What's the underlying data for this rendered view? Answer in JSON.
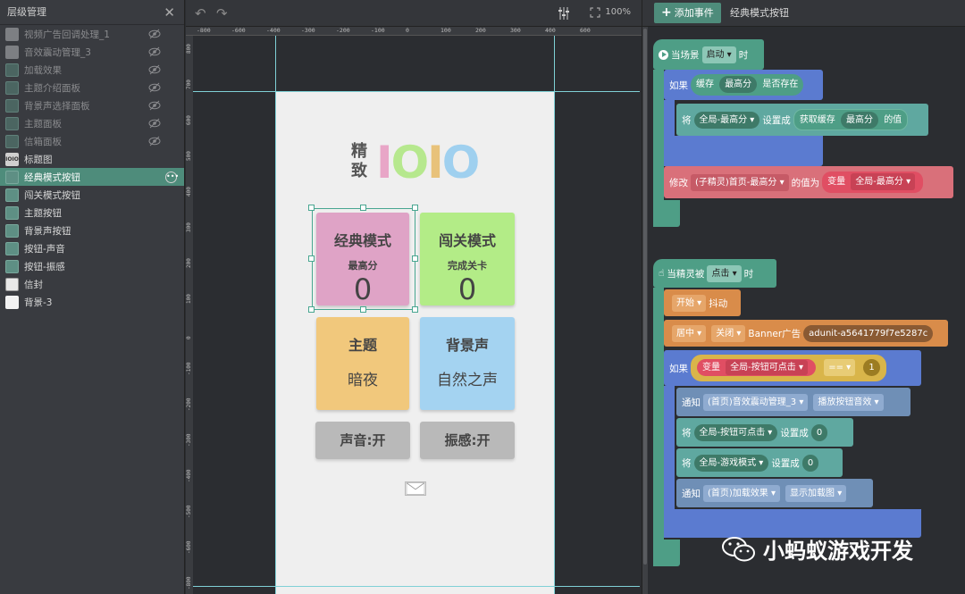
{
  "layers_panel": {
    "title": "层级管理",
    "items": [
      {
        "label": "视频广告回调处理_1",
        "icon": "grey-node-icon",
        "hidden": true
      },
      {
        "label": "音效震动管理_3",
        "icon": "grey-node-icon",
        "hidden": true
      },
      {
        "label": "加载效果",
        "icon": "image-node-icon",
        "hidden": true
      },
      {
        "label": "主题介绍面板",
        "icon": "image-node-icon",
        "hidden": true
      },
      {
        "label": "背景声选择面板",
        "icon": "image-node-icon",
        "hidden": true
      },
      {
        "label": "主题面板",
        "icon": "image-node-icon",
        "hidden": true
      },
      {
        "label": "信箱面板",
        "icon": "image-node-icon",
        "hidden": true
      },
      {
        "label": "标题图",
        "icon": "logo-node-icon",
        "hidden": false
      },
      {
        "label": "经典模式按钮",
        "icon": "image-node-icon",
        "hidden": false,
        "selected": true
      },
      {
        "label": "闯关模式按钮",
        "icon": "image-node-icon",
        "hidden": false
      },
      {
        "label": "主题按钮",
        "icon": "image-node-icon",
        "hidden": false
      },
      {
        "label": "背景声按钮",
        "icon": "image-node-icon",
        "hidden": false
      },
      {
        "label": "按钮-声音",
        "icon": "image-node-icon",
        "hidden": false
      },
      {
        "label": "按钮-振感",
        "icon": "image-node-icon",
        "hidden": false
      },
      {
        "label": "信封",
        "icon": "envelope-node-icon",
        "hidden": false
      },
      {
        "label": "背景-3",
        "icon": "white-node-icon",
        "hidden": false
      }
    ]
  },
  "canvas": {
    "zoom": "100%",
    "ruler_top": [
      "-800",
      "-600",
      "-400",
      "-300",
      "-200",
      "-100",
      "0",
      "100",
      "200",
      "300",
      "400",
      "600"
    ],
    "ruler_left": [
      "800",
      "700",
      "600",
      "500",
      "400",
      "300",
      "200",
      "100",
      "0",
      "-100",
      "-200",
      "-300",
      "-400",
      "-500",
      "-600",
      "-800"
    ],
    "game": {
      "logo_small": "精致",
      "logo_big": [
        "I",
        "O",
        "I",
        "O"
      ],
      "logo_colors": [
        "#e8a6c7",
        "#b6e88e",
        "#e8c27a",
        "#9fd0ef"
      ],
      "card_classic": {
        "title": "经典模式",
        "sub": "最高分",
        "num": "0",
        "color": "#dfa3c6"
      },
      "card_challenge": {
        "title": "闯关模式",
        "sub": "完成关卡",
        "num": "0",
        "color": "#b3ec87"
      },
      "card_theme": {
        "title": "主题",
        "value": "暗夜",
        "color": "#f1c87c"
      },
      "card_bgm": {
        "title": "背景声",
        "value": "自然之声",
        "color": "#a4d3f1"
      },
      "btn_sound": "声音:开",
      "btn_vibrate": "振感:开"
    }
  },
  "blocks_panel": {
    "add_event": "添加事件",
    "selected_name": "经典模式按钮",
    "event1": {
      "head": "当场景",
      "trigger": "启动",
      "suffix": "时",
      "if_label": "如果",
      "cache": "缓存",
      "key": "最高分",
      "exists": "是否存在",
      "set_prefix": "将",
      "var": "全局-最高分",
      "set_to": "设置成",
      "get_cache": "获取缓存",
      "get_key": "最高分",
      "value_of": "的值",
      "modify": "修改",
      "sprite": "(子精灵)首页-最高分",
      "value_is": "的值为",
      "variable": "变量",
      "var2": "全局-最高分"
    },
    "event2": {
      "head": "当精灵被",
      "trigger": "点击",
      "suffix": "时",
      "start": "开始",
      "shake": "抖动",
      "center": "居中",
      "close": "关闭",
      "banner": "Banner广告",
      "adunit": "adunit-a5641779f7e5287c",
      "if_label": "如果",
      "variable": "变量",
      "var": "全局-按钮可点击",
      "op": "==",
      "val": "1",
      "notify": "通知",
      "target1": "(首页)音效震动管理_3",
      "action1": "播放按钮音效",
      "set1_prefix": "将",
      "set1_var": "全局-按钮可点击",
      "set1_to": "设置成",
      "set1_val": "0",
      "set2_prefix": "将",
      "set2_var": "全局-游戏模式",
      "set2_to": "设置成",
      "set2_val": "0",
      "notify2": "通知",
      "target2": "(首页)加载效果",
      "action2": "显示加载图"
    },
    "watermark": "小蚂蚁游戏开发"
  }
}
